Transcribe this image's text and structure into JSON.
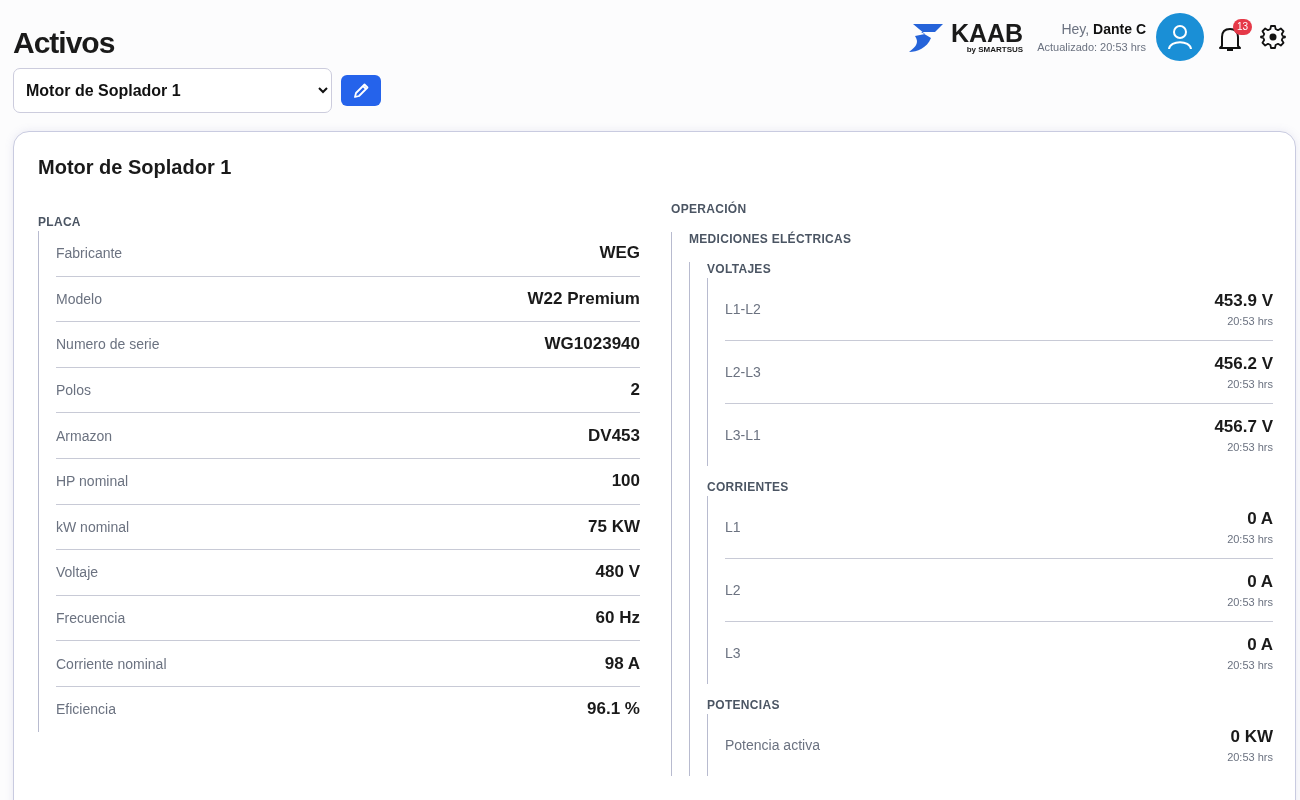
{
  "page": {
    "title": "Activos"
  },
  "asset_select": {
    "value": "Motor de Soplador 1"
  },
  "header": {
    "brand": "KAAB",
    "brand_sub": "by SMARTSUS",
    "greeting": "Hey, **Dante C**",
    "updated": "Actualizado: 20:53 hrs",
    "notifications": "13"
  },
  "card": {
    "title": "Motor de Soplador 1",
    "placa": {
      "heading": "PLACA",
      "rows": [
        {
          "label": "Fabricante",
          "value": "WEG"
        },
        {
          "label": "Modelo",
          "value": "W22 Premium"
        },
        {
          "label": "Numero de serie",
          "value": "WG1023940"
        },
        {
          "label": "Polos",
          "value": "2"
        },
        {
          "label": "Armazon",
          "value": "DV453"
        },
        {
          "label": "HP nominal",
          "value": "100"
        },
        {
          "label": "kW nominal",
          "value": "75 KW"
        },
        {
          "label": "Voltaje",
          "value": "480 V"
        },
        {
          "label": "Frecuencia",
          "value": "60 Hz"
        },
        {
          "label": "Corriente nominal",
          "value": "98 A"
        },
        {
          "label": "Eficiencia",
          "value": "96.1 %"
        }
      ]
    },
    "operacion": {
      "heading": "OPERACIÓN",
      "groups": [
        {
          "heading": "MEDICIONES ELÉCTRICAS",
          "subgroups": [
            {
              "heading": "VOLTAJES",
              "rows": [
                {
                  "label": "L1-L2",
                  "value": "453.9 V",
                  "time": "20:53 hrs"
                },
                {
                  "label": "L2-L3",
                  "value": "456.2 V",
                  "time": "20:53 hrs"
                },
                {
                  "label": "L3-L1",
                  "value": "456.7 V",
                  "time": "20:53 hrs"
                }
              ]
            },
            {
              "heading": "CORRIENTES",
              "rows": [
                {
                  "label": "L1",
                  "value": "0 A",
                  "time": "20:53 hrs"
                },
                {
                  "label": "L2",
                  "value": "0 A",
                  "time": "20:53 hrs"
                },
                {
                  "label": "L3",
                  "value": "0 A",
                  "time": "20:53 hrs"
                }
              ]
            },
            {
              "heading": "POTENCIAS",
              "rows": [
                {
                  "label": "Potencia activa",
                  "value": "0 KW",
                  "time": "20:53 hrs"
                }
              ]
            }
          ]
        }
      ]
    }
  }
}
